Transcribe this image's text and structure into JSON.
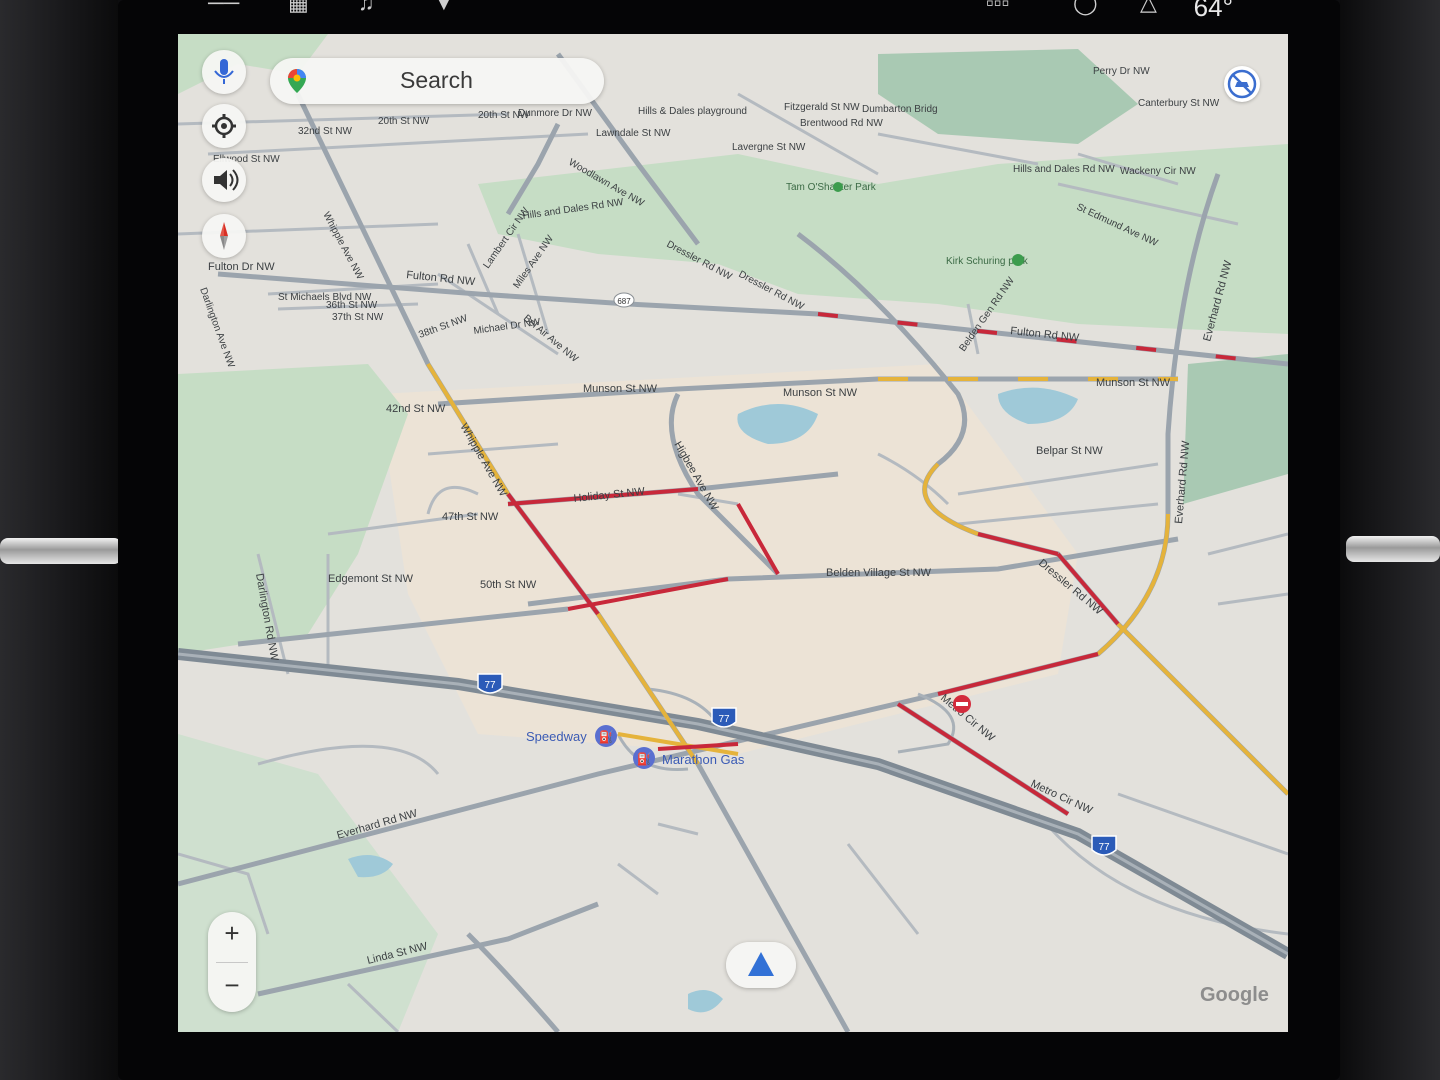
{
  "status": {
    "temperature": "64°"
  },
  "search": {
    "label": "Search"
  },
  "controls": {
    "mic": "mic-icon",
    "settings": "gear-icon",
    "volume": "volume-icon",
    "compass": "compass-icon",
    "zoom_in": "+",
    "zoom_out": "−",
    "traffic": "traffic-icon"
  },
  "watermark": "Google",
  "streets": {
    "s20th_a": "20th St NW",
    "s20th_b": "20th St NW",
    "s32nd": "32nd St NW",
    "dunmore": "Dunmore Dr NW",
    "elwood": "Ellwood St NW",
    "whipple_n": "Whipple Ave NW",
    "hills_dales": "Hills and Dales Rd NW",
    "hills_dales_e": "Hills and Dales Rd NW",
    "woodlawn": "Woodlawn Ave NW",
    "lambert": "Lambert Cir NW",
    "miles": "Miles Ave NW",
    "dressler_n": "Dressler Rd NW",
    "dressler_n2": "Dressler Rd NW",
    "fulton_w": "Fulton Dr NW",
    "fulton_c": "Fulton Rd NW",
    "fulton_e": "Fulton Rd NW",
    "st_michaels": "St Michaels Blvd NW",
    "s36th": "36th St NW",
    "s37th": "37th St NW",
    "darlington_n": "Darlington Ave NW",
    "s38th": "38th St NW",
    "michael": "Michael Dr NW",
    "bel_air": "Bel Air Ave NW",
    "munson_w": "Munson St NW",
    "munson_c": "Munson St NW",
    "munson_e": "Munson St NW",
    "s42nd": "42nd St NW",
    "whipple_c": "Whipple Ave NW",
    "higbee": "Higbee Ave NW",
    "belpar": "Belpar St NW",
    "everhard_n": "Everhard Rd NW",
    "everhard_c": "Everhard Rd NW",
    "holiday": "Holiday St NW",
    "s47th": "47th St NW",
    "belden": "Belden Village St NW",
    "edgemont": "Edgemont St NW",
    "s50th": "50th St NW",
    "dressler_s": "Dressler Rd NW",
    "darlington_s": "Darlington Rd NW",
    "metro_cir_a": "Metro Cir NW",
    "metro_cir_b": "Metro Cir NW",
    "everhard_sw": "Everhard Rd NW",
    "linda": "Linda St NW",
    "st_edmund": "St Edmund Ave NW",
    "wackeny": "Wackeny Cir NW",
    "canterbury": "Canterbury St NW",
    "perry": "Perry Dr NW",
    "belden_gen": "Belden Gen Rd NW",
    "fitzgerald": "Fitzgerald St NW",
    "dumbarton": "Dumbarton Bridg",
    "brentwood": "Brentwood Rd NW",
    "hills_playground": "Hills & Dales playground",
    "lavergne": "Lavergne St NW",
    "lawndale": "Lawndale St NW"
  },
  "places": {
    "tam_oshanter": "Tam O'Shanter Park",
    "kirk_schuring": "Kirk Schuring park",
    "speedway": "Speedway",
    "marathon": "Marathon Gas"
  },
  "shields": {
    "i77_a": "77",
    "i77_b": "77",
    "i77_c": "77",
    "r687": "687"
  },
  "colors": {
    "land": "#e3e1dc",
    "park": "#c6ddc5",
    "forest": "#a9c9b3",
    "water": "#9fc9d8",
    "road": "#9ba4ad",
    "highway": "#7f8a94",
    "traffic_red": "#c8283a",
    "traffic_yellow": "#e5b33b",
    "label": "#3c4043",
    "poi": "#3b5bb5",
    "nav_arrow": "#3271d6"
  }
}
